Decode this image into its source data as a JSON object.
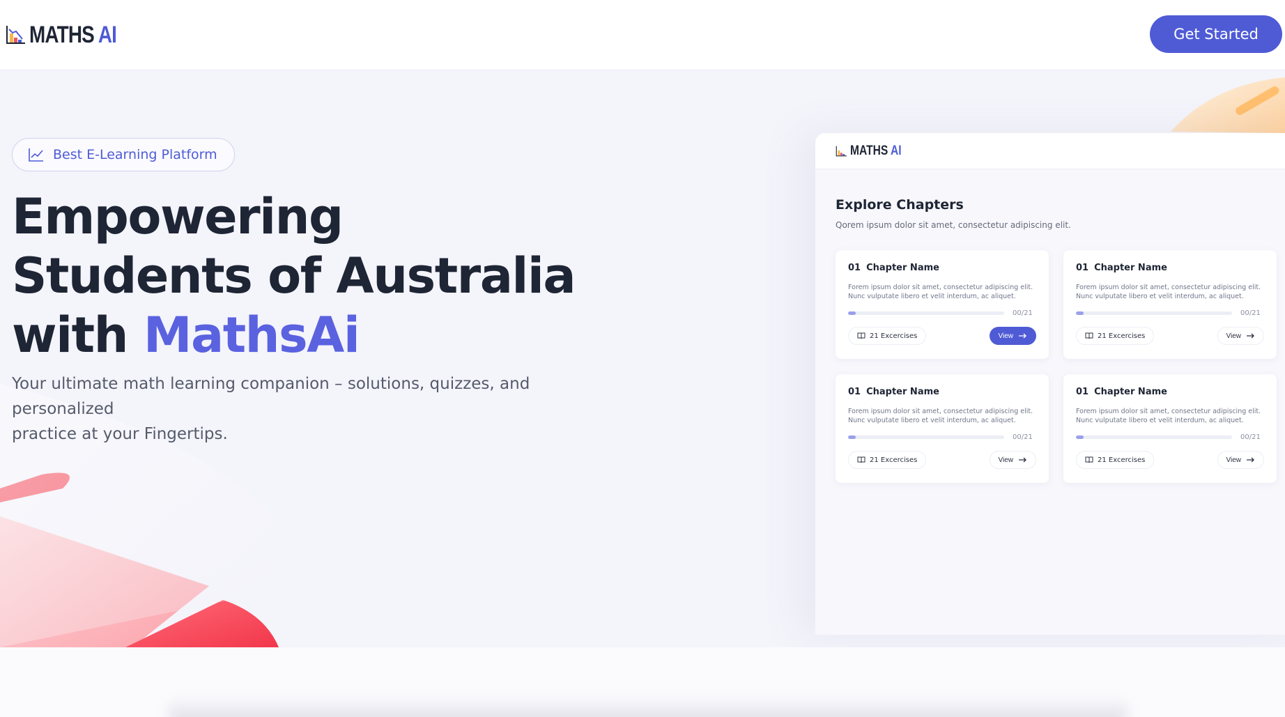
{
  "nav": {
    "logo_main": "MATHS",
    "logo_accent": "AI",
    "cta_label": "Get Started"
  },
  "hero": {
    "badge_label": "Best E-Learning Platform",
    "headline_line1": "Empowering",
    "headline_line2": "Students of Australia",
    "headline_line3_prefix": "with ",
    "headline_line3_accent": "MathsAi",
    "subtext_line1": "Your ultimate math learning companion – solutions, quizzes, and personalized",
    "subtext_line2": "practice at your Fingertips."
  },
  "mock": {
    "logo_main": "MATHS",
    "logo_accent": "AI",
    "title": "Explore Chapters",
    "subtitle": "Qorem ipsum dolor sit amet, consectetur adipiscing elit.",
    "cards": [
      {
        "number": "01",
        "name": "Chapter Name",
        "desc": "Forem ipsum dolor sit amet, consectetur adipiscing elit. Nunc vulputate libero et velit interdum, ac aliquet.",
        "progress_text": "00/21",
        "progress": 0.05,
        "exercises": "21 Excercises",
        "view": "View",
        "active": true
      },
      {
        "number": "01",
        "name": "Chapter Name",
        "desc": "Forem ipsum dolor sit amet, consectetur adipiscing elit. Nunc vulputate libero et velit interdum, ac aliquet.",
        "progress_text": "00/21",
        "progress": 0.05,
        "exercises": "21 Excercises",
        "view": "View",
        "active": false
      },
      {
        "number": "01",
        "name": "Chapter Name",
        "desc": "Forem ipsum dolor sit amet, consectetur adipiscing elit. Nunc vulputate libero et velit interdum, ac aliquet.",
        "progress_text": "00/21",
        "progress": 0.05,
        "exercises": "21 Excercises",
        "view": "View",
        "active": false
      },
      {
        "number": "01",
        "name": "Chapter Name",
        "desc": "Forem ipsum dolor sit amet, consectetur adipiscing elit. Nunc vulputate libero et velit interdum, ac aliquet.",
        "progress_text": "00/21",
        "progress": 0.05,
        "exercises": "21 Excercises",
        "view": "View",
        "active": false
      }
    ]
  },
  "colors": {
    "accent": "#4f5bd5",
    "heading": "#1e2534",
    "hero_bg": "#f4f4fb"
  }
}
